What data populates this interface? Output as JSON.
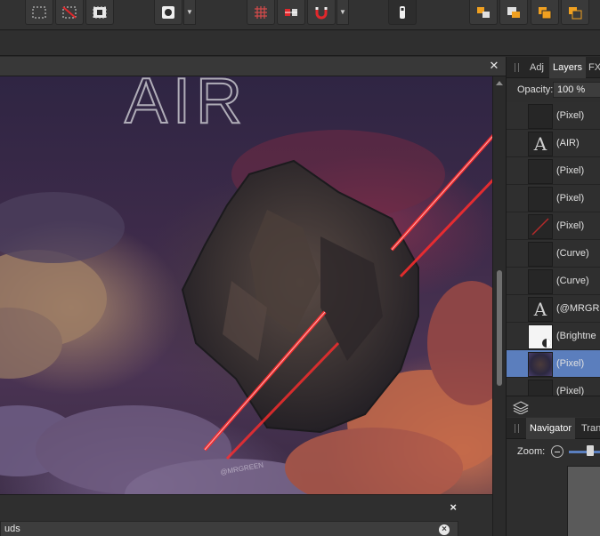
{
  "toolbar": {
    "icons": [
      "marquee-select-icon",
      "deselect-icon",
      "invert-selection-icon",
      "circle-brush-icon",
      "snapping-grid-icon",
      "flip-icon",
      "magnet-icon",
      "quick-mask-icon",
      "arrange-back-icon",
      "arrange-backward-icon",
      "arrange-forward-icon",
      "arrange-front-icon"
    ]
  },
  "canvas": {
    "title_text": "AIR",
    "watermark": "@MRGREEN"
  },
  "bottom_panel": {
    "close_label": "×",
    "search_value": "uds",
    "clear_label": "×"
  },
  "right_panel": {
    "tabs": [
      "Adj",
      "Layers",
      "FX"
    ],
    "active_tab": "Layers",
    "opacity_label": "Opacity:",
    "opacity_value": "100 %",
    "layers": [
      {
        "name": "(Pixel)",
        "thumb": "dark"
      },
      {
        "name": "(AIR)",
        "thumb": "text"
      },
      {
        "name": "(Pixel)",
        "thumb": "dark"
      },
      {
        "name": "(Pixel)",
        "thumb": "dark"
      },
      {
        "name": "(Pixel)",
        "thumb": "red-line"
      },
      {
        "name": "(Curve)",
        "thumb": "dark"
      },
      {
        "name": "(Curve)",
        "thumb": "dark"
      },
      {
        "name": "(@MRGR",
        "thumb": "text"
      },
      {
        "name": "(Brightne",
        "thumb": "white"
      },
      {
        "name": "(Pixel)",
        "thumb": "image",
        "selected": true
      },
      {
        "name": "(Pixel)",
        "thumb": "dark"
      }
    ],
    "text_thumb_glyph": "A",
    "nav_tabs": [
      "Navigator",
      "Tran"
    ],
    "zoom_label": "Zoom:"
  },
  "colors": {
    "selection": "#5b7ebd",
    "laser": "#e0282c",
    "panel_bg": "#2e2e2e"
  }
}
